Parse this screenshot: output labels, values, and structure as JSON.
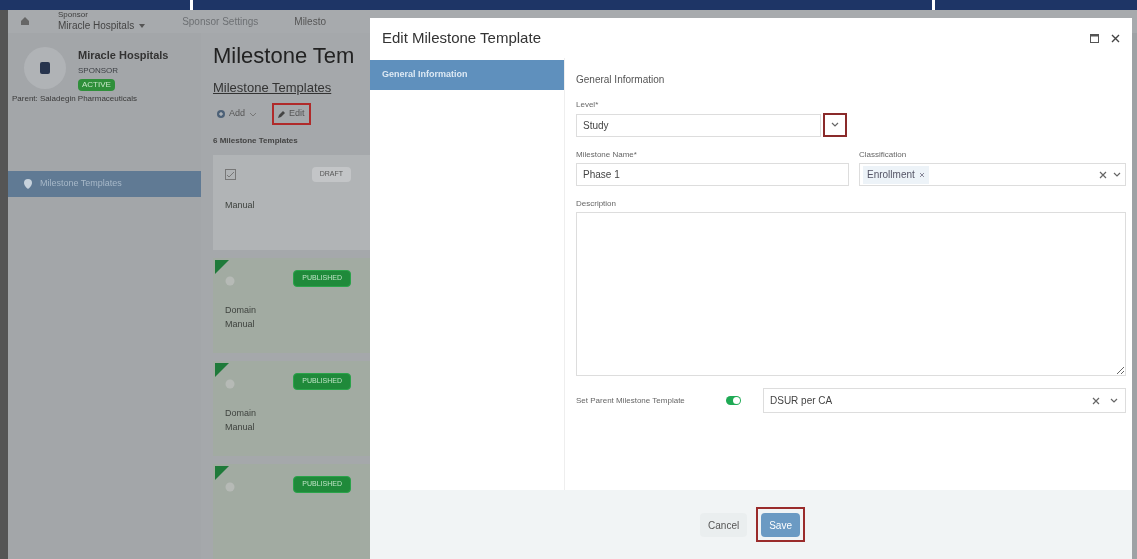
{
  "header": {
    "sponsor_label": "Sponsor",
    "sponsor_name": "Miracle Hospitals",
    "tabs": [
      {
        "label": "Sponsor Settings",
        "selected": false
      },
      {
        "label": "Milesto",
        "selected": true
      }
    ]
  },
  "sidebar": {
    "name": "Miracle Hospitals",
    "role": "SPONSOR",
    "status": "ACTIVE",
    "parent": "Parent: Saladegin Pharmaceuticals",
    "items": [
      {
        "label": "Milestone Templates",
        "selected": true
      }
    ]
  },
  "main": {
    "title": "Milestone Tem",
    "breadcrumb": "Milestone Templates",
    "toolbar": [
      {
        "label": "Add",
        "kind": "dropdown",
        "highlighted": false
      },
      {
        "label": "Edit",
        "kind": "edit",
        "highlighted": true
      }
    ],
    "count": "6 Milestone Templates",
    "cards": [
      {
        "status": "DRAFT",
        "kind": "draft",
        "lines": [
          "Manual"
        ]
      },
      {
        "status": "PUBLISHED",
        "kind": "published",
        "lines": [
          "Domain",
          "Manual"
        ]
      },
      {
        "status": "PUBLISHED",
        "kind": "published",
        "lines": [
          "Domain",
          "Manual"
        ]
      },
      {
        "status": "PUBLISHED",
        "kind": "published"
      }
    ]
  },
  "modal": {
    "title": "Edit Milestone Template",
    "nav": [
      {
        "label": "General Information",
        "selected": true
      }
    ],
    "section": "General Information",
    "level": {
      "label": "Level*",
      "value": "Study",
      "chevron_highlighted": true
    },
    "name": {
      "label": "Milestone Name*",
      "value": "Phase 1"
    },
    "classification": {
      "label": "Classification",
      "tags": [
        "Enrollment"
      ]
    },
    "description": {
      "label": "Description"
    },
    "parent": {
      "label": "Set Parent Milestone Template",
      "on": true,
      "value": "DSUR per CA"
    },
    "buttons": [
      {
        "label": "Cancel",
        "kind": "secondary",
        "highlighted": false
      },
      {
        "label": "Save",
        "kind": "primary",
        "highlighted": true
      }
    ]
  }
}
